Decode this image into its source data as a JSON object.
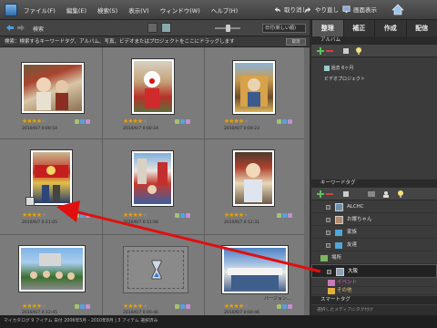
{
  "menubar": {
    "items": [
      "ファイル(F)",
      "編集(E)",
      "検索(S)",
      "表示(V)",
      "ウィンドウ(W)",
      "ヘルプ(H)"
    ],
    "undo_label": "取り消し",
    "redo_label": "やり直し",
    "view_label": "画面表示"
  },
  "toolbar": {
    "search_label": "検索",
    "sort_value": "日付(新しい順)"
  },
  "tabs": [
    {
      "label": "整理",
      "active": true
    },
    {
      "label": "補正",
      "active": false
    },
    {
      "label": "作成",
      "active": false
    },
    {
      "label": "配信",
      "active": false
    }
  ],
  "hint": {
    "text": "検索：検索するキーワードタグ、アルバム、写真、ビデオまたはプロジェクトをここにドラッグします",
    "button": "取消"
  },
  "photos": [
    {
      "date": "2010/6/7 0:00:54",
      "stars": 4,
      "tags": [
        "#a7c26d",
        "#5aa0de",
        "#c48fcf"
      ]
    },
    {
      "date": "2010/6/7 0:00:34",
      "stars": 4,
      "tags": [
        "#a7c26d",
        "#5aa0de",
        "#c48fcf"
      ]
    },
    {
      "date": "2010/6/7 0:00:23",
      "stars": 4,
      "tags": [
        "#a7c26d",
        "#5aa0de",
        "#c48fcf"
      ]
    },
    {
      "date": "2010/6/7 0:11:05",
      "stars": 4,
      "tags": [
        "#a7c26d",
        "#5aa0de",
        "#c48fcf"
      ]
    },
    {
      "date": "2010/6/7 0:11:06",
      "stars": 4,
      "tags": [
        "#a7c26d",
        "#5aa0de",
        "#c48fcf"
      ]
    },
    {
      "date": "2010/6/7 0:12:31",
      "stars": 4,
      "tags": [
        "#a7c26d",
        "#5aa0de",
        "#c48fcf"
      ]
    },
    {
      "date": "2010/6/7 0:12:45",
      "stars": 4,
      "tags": [
        "#a7c26d",
        "#5aa0de",
        "#c48fcf"
      ]
    },
    {
      "date": "2010/6/7 0:00:46",
      "stars": 4,
      "tags": [
        "#a7c26d",
        "#5aa0de",
        "#c48fcf"
      ]
    },
    {
      "date": "2010/6/7 0:00:46",
      "stars": 4,
      "tags": [
        "#a7c26d",
        "#5aa0de",
        "#c48fcf"
      ]
    }
  ],
  "grid_overlay_text": "バージョン...",
  "panel": {
    "album_header": "アルバム",
    "albums": [
      "過去 6ヶ月",
      "ビデオプロジェクト"
    ],
    "keyword_header": "キーワードタグ",
    "keywords": [
      {
        "label": "ALCHC",
        "type": "person"
      },
      {
        "label": "お嬢ちゃん",
        "type": "person"
      },
      {
        "label": "家族",
        "type": "person"
      },
      {
        "label": "友達",
        "type": "person"
      },
      {
        "label": "場所",
        "type": "category"
      },
      {
        "label": "大阪",
        "type": "place",
        "selected": true
      },
      {
        "label": "イベント",
        "type": "category"
      },
      {
        "label": "その他",
        "type": "category"
      }
    ],
    "smart_tag_header": "スマートタグ",
    "footer_label": "選択したメディアにタグ付け"
  },
  "status": {
    "text": "マイカタログ  9 アイテム 日付 2006年5月 - 2010年8月  |  3 アイテム 選択済み"
  },
  "colors": {
    "accent_red": "#e01010",
    "star": "#e9a100"
  }
}
